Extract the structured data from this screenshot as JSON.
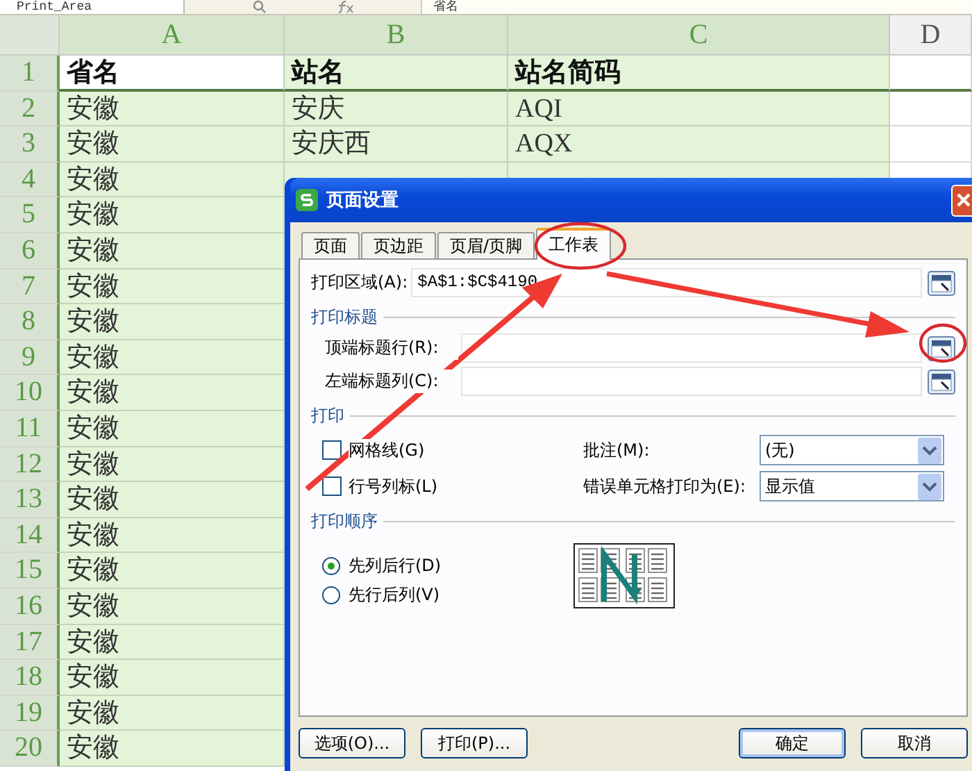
{
  "toolbar": {
    "name_box": "Print_Area",
    "formula": "省名"
  },
  "sheet": {
    "columns": [
      {
        "label": "A",
        "selected": true
      },
      {
        "label": "B",
        "selected": true
      },
      {
        "label": "C",
        "selected": true
      },
      {
        "label": "D",
        "selected": false
      }
    ],
    "rows": [
      {
        "number": "1",
        "kind": "header",
        "selected": true,
        "cells": [
          {
            "text": "省名",
            "active": true
          },
          {
            "text": "站名",
            "active": false
          },
          {
            "text": "站名简码",
            "active": false
          }
        ]
      },
      {
        "number": "2",
        "kind": "data",
        "selected": true,
        "cells": [
          {
            "text": "安徽",
            "active": false
          },
          {
            "text": "安庆",
            "active": false
          },
          {
            "text": "AQI",
            "active": false
          }
        ]
      },
      {
        "number": "3",
        "kind": "data",
        "selected": true,
        "cells": [
          {
            "text": "安徽",
            "active": false
          },
          {
            "text": "安庆西",
            "active": false
          },
          {
            "text": "AQX",
            "active": false
          }
        ]
      },
      {
        "number": "4",
        "kind": "data",
        "selected": true,
        "cells": [
          {
            "text": "安徽",
            "active": false
          }
        ]
      },
      {
        "number": "5",
        "kind": "data",
        "selected": true,
        "cells": [
          {
            "text": "安徽",
            "active": false
          }
        ]
      },
      {
        "number": "6",
        "kind": "data",
        "selected": true,
        "cells": [
          {
            "text": "安徽",
            "active": false
          }
        ]
      },
      {
        "number": "7",
        "kind": "data",
        "selected": true,
        "cells": [
          {
            "text": "安徽",
            "active": false
          }
        ]
      },
      {
        "number": "8",
        "kind": "data",
        "selected": true,
        "cells": [
          {
            "text": "安徽",
            "active": false
          }
        ]
      },
      {
        "number": "9",
        "kind": "data",
        "selected": true,
        "cells": [
          {
            "text": "安徽",
            "active": false
          }
        ]
      },
      {
        "number": "10",
        "kind": "data",
        "selected": true,
        "cells": [
          {
            "text": "安徽",
            "active": false
          }
        ]
      },
      {
        "number": "11",
        "kind": "data",
        "selected": true,
        "cells": [
          {
            "text": "安徽",
            "active": false
          }
        ]
      },
      {
        "number": "12",
        "kind": "data",
        "selected": true,
        "cells": [
          {
            "text": "安徽",
            "active": false
          }
        ]
      },
      {
        "number": "13",
        "kind": "data",
        "selected": true,
        "cells": [
          {
            "text": "安徽",
            "active": false
          }
        ]
      },
      {
        "number": "14",
        "kind": "data",
        "selected": true,
        "cells": [
          {
            "text": "安徽",
            "active": false
          }
        ]
      },
      {
        "number": "15",
        "kind": "data",
        "selected": true,
        "cells": [
          {
            "text": "安徽",
            "active": false
          }
        ]
      },
      {
        "number": "16",
        "kind": "data",
        "selected": true,
        "cells": [
          {
            "text": "安徽",
            "active": false
          }
        ]
      },
      {
        "number": "17",
        "kind": "data",
        "selected": true,
        "cells": [
          {
            "text": "安徽",
            "active": false
          }
        ]
      },
      {
        "number": "18",
        "kind": "data",
        "selected": true,
        "cells": [
          {
            "text": "安徽",
            "active": false
          }
        ]
      },
      {
        "number": "19",
        "kind": "data",
        "selected": true,
        "cells": [
          {
            "text": "安徽",
            "active": false
          }
        ]
      },
      {
        "number": "20",
        "kind": "data",
        "selected": true,
        "cells": [
          {
            "text": "安徽",
            "active": false
          }
        ]
      }
    ]
  },
  "dialog": {
    "title": "页面设置",
    "tabs": [
      {
        "label": "页面",
        "selected": false
      },
      {
        "label": "页边距",
        "selected": false
      },
      {
        "label": "页眉/页脚",
        "selected": false
      },
      {
        "label": "工作表",
        "selected": true
      }
    ],
    "print_area": {
      "label": "打印区域(A):",
      "value": "$A$1:$C$4190"
    },
    "print_titles": {
      "heading": "打印标题",
      "fields": [
        {
          "label": "顶端标题行(R):"
        },
        {
          "label": "左端标题列(C):"
        }
      ]
    },
    "print": {
      "heading": "打印",
      "checkboxes": [
        {
          "label": "网格线(G)",
          "checked": false
        },
        {
          "label": "行号列标(L)",
          "checked": false
        }
      ],
      "selects": [
        {
          "label": "批注(M):",
          "value": "(无)"
        },
        {
          "label": "错误单元格打印为(E):",
          "value": "显示值"
        }
      ]
    },
    "order": {
      "heading": "打印顺序",
      "options": [
        {
          "label": "先列后行(D)",
          "selected": true
        },
        {
          "label": "先行后列(V)",
          "selected": false
        }
      ]
    },
    "buttons": [
      {
        "label": "选项(O)...",
        "default": false
      },
      {
        "label": "打印(P)...",
        "default": false
      },
      {
        "label": "确定",
        "default": true
      },
      {
        "label": "取消",
        "default": false
      }
    ]
  }
}
